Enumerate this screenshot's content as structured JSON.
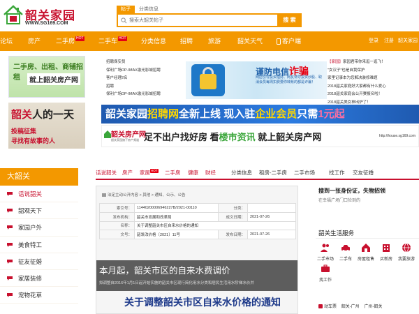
{
  "logo": {
    "title": "韶关家园",
    "url": "WWW.SG169.COM"
  },
  "search": {
    "tabs": [
      "帖子",
      "分类信息"
    ],
    "placeholder": "搜索大韶关帖子",
    "button": "搜 索"
  },
  "nav": {
    "items": [
      "论坛",
      "房产",
      "二手房",
      "二手车",
      "分类信息",
      "招聘",
      "旅游",
      "韶关天气",
      "客户端"
    ],
    "hot_badge": "HOT",
    "login": "登录",
    "register": "注册",
    "promo": "韶关家园"
  },
  "banner_house": {
    "line1": "二手房、出租、商铺招租",
    "line2": "就上韶关房产网"
  },
  "banner_person": {
    "title_a": "韶关",
    "title_b": "人的一天",
    "sub1": "投稿征集",
    "sub2": "寻找有故事的人"
  },
  "list_left": [
    "招聘保安员",
    "保利广场DP-IMAX激光影城招聘",
    "客户经理2名",
    "招聘",
    "保利广场DP-IMAX激光影城招聘"
  ],
  "banner_telecom": {
    "title": "谨防电信",
    "title_red": "诈骗",
    "desc": "网店引导投资理财、网友诱导投资炒股、取消会员每周扣费要你转账的都是诈骗！"
  },
  "list_right": [
    {
      "tag": "【家园】",
      "text": "家园君带你来逛一逛飞！"
    },
    {
      "tag": "",
      "text": "\"女汉子\"也是自我保护"
    },
    {
      "tag": "",
      "text": "家里记事本为您解决装修难题"
    },
    {
      "tag": "",
      "text": "2018韶关家庭好大家都有什么爱心"
    },
    {
      "tag": "",
      "text": "2018韶关家庭会公开赛报名啦！"
    },
    {
      "tag": "",
      "text": "2018韶关美女神出炉了！"
    }
  ],
  "banner_recruit": {
    "prefix": "韶关家园",
    "yellow": "招聘网",
    "mid": "全新上线 现入驻",
    "yellow2": "企业会员",
    "only": "只需",
    "price": "1元起"
  },
  "banner_estate": {
    "name": "韶关房产网",
    "tagline": "韶关家园旗下房产频道",
    "text_a": "足不出户找好房",
    "text_b": "看",
    "text_c": "楼市资讯",
    "text_d": "就上韶关房产网",
    "url": "http://house.sg169.com"
  },
  "left_menu": {
    "header": "大韶关",
    "items": [
      "话说韶关",
      "韶观天下",
      "家园户外",
      "美食特工",
      "征友征婚",
      "家居装修",
      "宠物花草"
    ]
  },
  "tabs2": {
    "items": [
      {
        "label": "话说韶关",
        "red": true,
        "hot": false
      },
      {
        "label": "房产",
        "red": true,
        "hot": false
      },
      {
        "label": "家居",
        "red": true,
        "hot": true
      },
      {
        "label": "二手房",
        "red": true,
        "hot": false
      },
      {
        "label": "健康",
        "red": true,
        "hot": false
      },
      {
        "label": "财经",
        "red": true,
        "hot": false
      },
      {
        "label": "分类信息",
        "red": false,
        "hot": false
      },
      {
        "label": "租房-二手房",
        "red": false,
        "hot": false
      },
      {
        "label": "二手市场",
        "red": false,
        "hot": false
      },
      {
        "label": "找工作",
        "red": false,
        "hot": false
      },
      {
        "label": "交友征婚",
        "red": false,
        "hot": false
      }
    ],
    "hot_badge": "HOT"
  },
  "doc": {
    "breadcrumb": "法定主动公开内容 > 其他 > 通知、公示、公告",
    "rows": [
      {
        "k1": "索引号：",
        "v1": "11440200006946227B/2021-00110",
        "k2": "分类：",
        "v2": ""
      },
      {
        "k1": "发布机构：",
        "v1": "韶关市发展和改革局",
        "k2": "成文日期：",
        "v2": "2021-07-26"
      },
      {
        "k1": "名称：",
        "v1": "关于调整韶关市区自来水价格的通知",
        "k2": "",
        "v2": ""
      },
      {
        "k1": "文号：",
        "v1": "韶发改价格〔2021〕11号",
        "k2": "发布日期：",
        "v2": "2021-07-26"
      }
    ],
    "overlay_title": "本月起，韶关市区的自来水费调价",
    "overlay_sub": "拟调整自2016年1月1日起开始实施的韶关市区现行简化用水分类和居民生活用水阶梯水价并",
    "big_title": "关于调整韶关市区自来水价格的通知"
  },
  "right_box": {
    "title": "搜到一张身份证，失物招领",
    "sub": "在幸福广场门口捡到的"
  },
  "life": {
    "header": "韶关生活服务",
    "items": [
      "二手市场",
      "二手车",
      "房屋租售",
      "买新房",
      "我要旅游",
      "找工作"
    ],
    "links": [
      "动车票",
      "韶关-广州",
      "广州-韶关"
    ]
  }
}
